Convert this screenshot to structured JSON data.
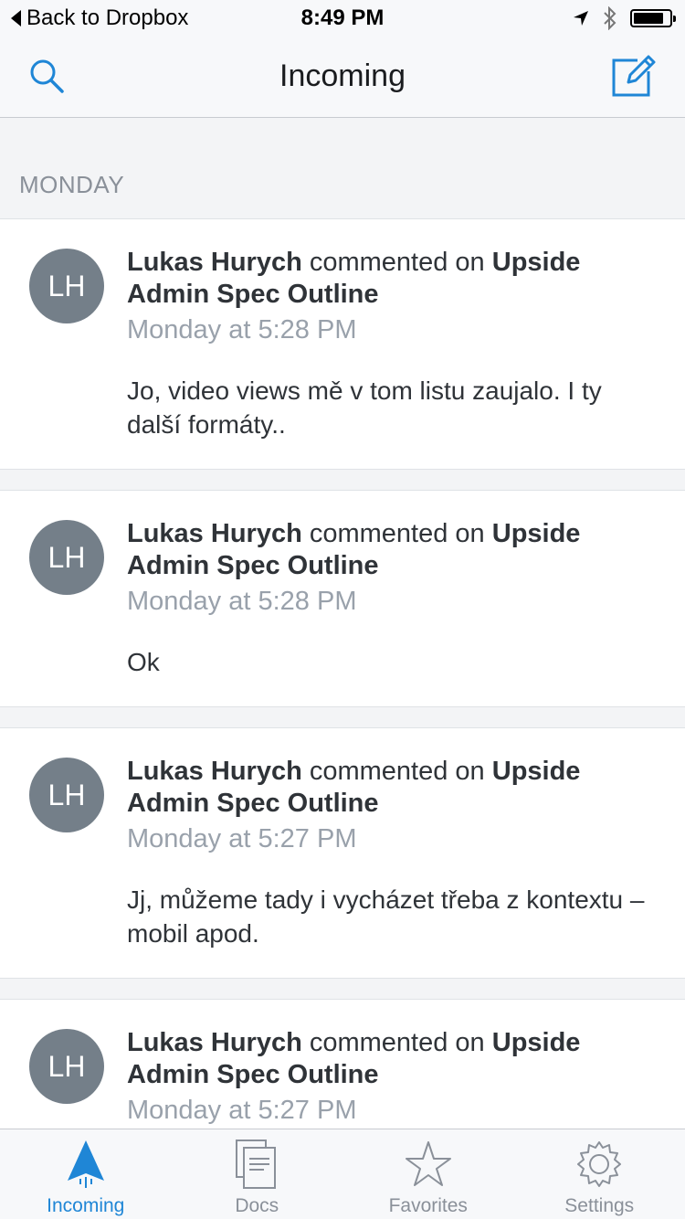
{
  "status_bar": {
    "back_label": "Back to Dropbox",
    "time": "8:49 PM",
    "battery_level_percent": 85
  },
  "nav": {
    "title": "Incoming",
    "search_icon": "search-icon",
    "compose_icon": "compose-icon"
  },
  "section": {
    "label": "MONDAY"
  },
  "feed": [
    {
      "initials": "LH",
      "author": "Lukas Hurych",
      "action": "commented on",
      "doc": "Upside Admin Spec Outline",
      "time": "Monday at 5:28 PM",
      "comment": "Jo, video views mě v tom listu zaujalo. I ty další formáty.."
    },
    {
      "initials": "LH",
      "author": "Lukas Hurych",
      "action": "commented on",
      "doc": "Upside Admin Spec Outline",
      "time": "Monday at 5:28 PM",
      "comment": "Ok"
    },
    {
      "initials": "LH",
      "author": "Lukas Hurych",
      "action": "commented on",
      "doc": "Upside Admin Spec Outline",
      "time": "Monday at 5:27 PM",
      "comment": "Jj, můžeme tady i vycházet třeba z kontextu – mobil apod."
    },
    {
      "initials": "LH",
      "author": "Lukas Hurych",
      "action": "commented on",
      "doc": "Upside Admin Spec Outline",
      "time": "Monday at 5:27 PM",
      "comment": ""
    }
  ],
  "tabs": [
    {
      "label": "Incoming",
      "icon": "paper-plane-icon",
      "active": true
    },
    {
      "label": "Docs",
      "icon": "documents-icon",
      "active": false
    },
    {
      "label": "Favorites",
      "icon": "star-icon",
      "active": false
    },
    {
      "label": "Settings",
      "icon": "gear-icon",
      "active": false
    }
  ],
  "colors": {
    "accent": "#1f86d6",
    "avatar": "#747f89",
    "muted": "#99a1ab",
    "background": "#f3f4f6"
  }
}
